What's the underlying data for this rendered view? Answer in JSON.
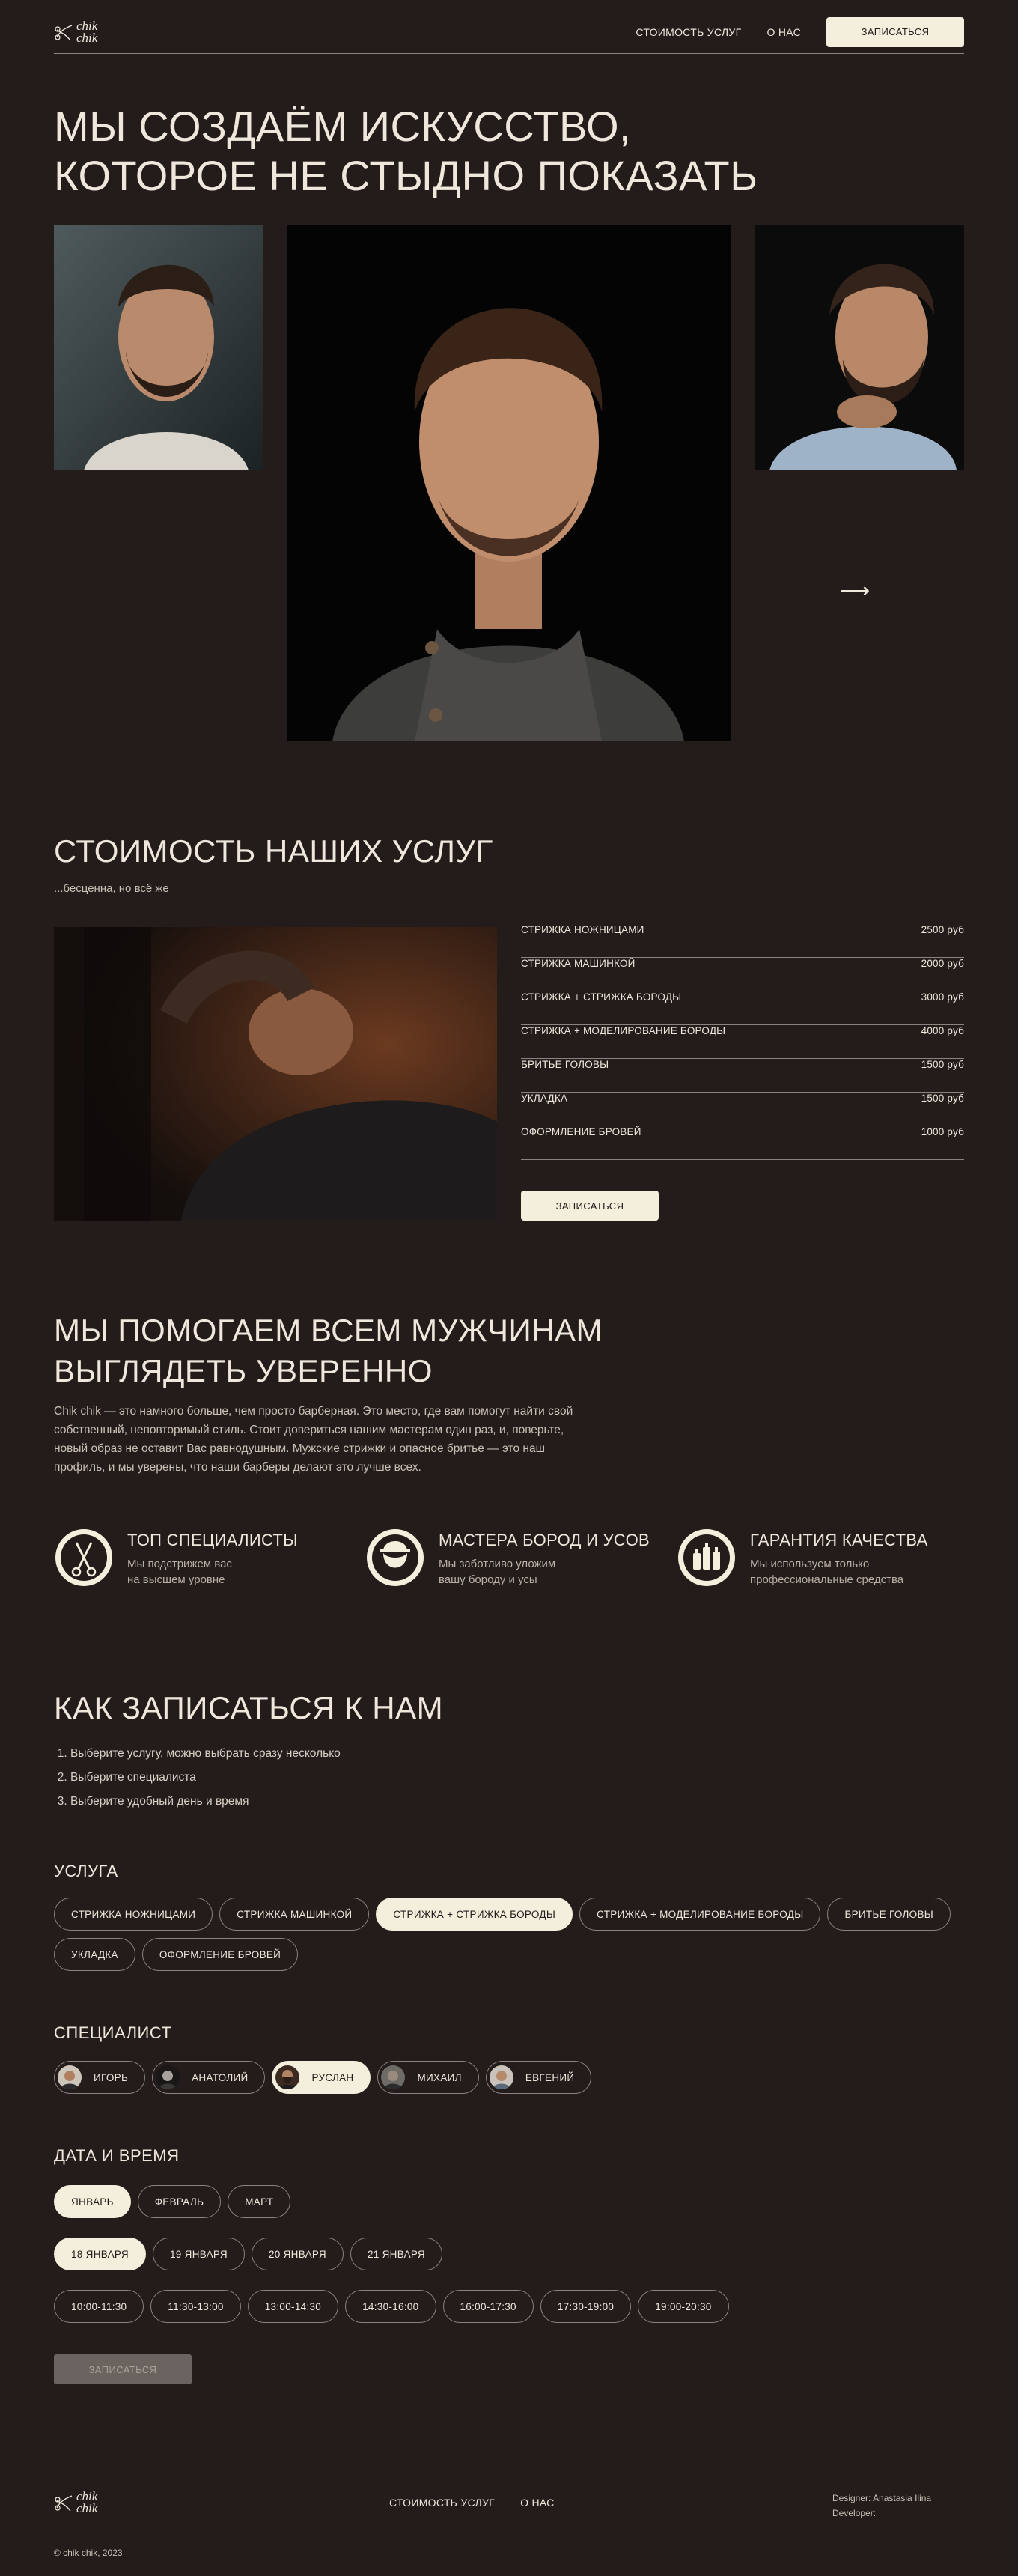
{
  "brand": {
    "logo_line1": "chik",
    "logo_line2": "chik"
  },
  "nav": {
    "prices": "СТОИМОСТЬ УСЛУГ",
    "about": "О НАС",
    "book_button": "ЗАПИСАТЬСЯ"
  },
  "hero": {
    "title_line1": "МЫ СОЗДАЁМ ИСКУССТВО,",
    "title_line2": "КОТОРОЕ НЕ СТЫДНО ПОКАЗАТЬ",
    "arrow": "⟶"
  },
  "prices": {
    "title": "СТОИМОСТЬ НАШИХ УСЛУГ",
    "subtitle": "...бесценна, но всё же",
    "items": [
      {
        "name": "СТРИЖКА НОЖНИЦАМИ",
        "price": "2500 руб"
      },
      {
        "name": "СТРИЖКА МАШИНКОЙ",
        "price": "2000 руб"
      },
      {
        "name": "СТРИЖКА + СТРИЖКА БОРОДЫ",
        "price": "3000 руб"
      },
      {
        "name": "СТРИЖКА + МОДЕЛИРОВАНИЕ БОРОДЫ",
        "price": "4000 руб"
      },
      {
        "name": "БРИТЬЕ ГОЛОВЫ",
        "price": "1500 руб"
      },
      {
        "name": "УКЛАДКА",
        "price": "1500 руб"
      },
      {
        "name": "ОФОРМЛЕНИЕ БРОВЕЙ",
        "price": "1000 руб"
      }
    ],
    "book_button": "ЗАПИСАТЬСЯ"
  },
  "about": {
    "title_line1": "МЫ ПОМОГАЕМ ВСЕМ МУЖЧИНАМ",
    "title_line2": "ВЫГЛЯДЕТЬ УВЕРЕННО",
    "text": "Chik chik — это намного больше, чем просто барберная. Это место, где вам помогут найти свой собственный, неповторимый стиль. Стоит довериться нашим мастерам один раз, и, поверьте, новый образ не оставит Вас равнодушным. Мужские стрижки и опасное бритье — это наш профиль, и мы уверены, что наши барберы делают это лучше всех.",
    "features": [
      {
        "title": "ТОП СПЕЦИАЛИСТЫ",
        "sub1": "Мы подстрижем вас",
        "sub2": "на высшем уровне",
        "icon": "scissors-icon"
      },
      {
        "title": "МАСТЕРА БОРОД И УСОВ",
        "sub1": "Мы заботливо уложим",
        "sub2": "вашу бороду и усы",
        "icon": "bearded-man-icon"
      },
      {
        "title": "ГАРАНТИЯ КАЧЕСТВА",
        "sub1": "Мы используем только",
        "sub2": "профессиональные средства",
        "icon": "bottles-icon"
      }
    ]
  },
  "booking": {
    "title": "КАК ЗАПИСАТЬСЯ К НАМ",
    "steps": [
      "Выберите услугу, можно выбрать сразу несколько",
      "Выберите специалиста",
      "Выберите удобный день и время"
    ],
    "service_label": "УСЛУГА",
    "services": [
      "СТРИЖКА НОЖНИЦАМИ",
      "СТРИЖКА МАШИНКОЙ",
      "СТРИЖКА + СТРИЖКА БОРОДЫ",
      "СТРИЖКА + МОДЕЛИРОВАНИЕ БОРОДЫ",
      "БРИТЬЕ ГОЛОВЫ",
      "УКЛАДКА",
      "ОФОРМЛЕНИЕ БРОВЕЙ"
    ],
    "service_selected": 2,
    "specialist_label": "СПЕЦИАЛИСТ",
    "specialists": [
      "ИГОРЬ",
      "АНАТОЛИЙ",
      "РУСЛАН",
      "МИХАИЛ",
      "ЕВГЕНИЙ"
    ],
    "specialist_selected": 2,
    "datetime_label": "ДАТА И ВРЕМЯ",
    "months": [
      "ЯНВАРЬ",
      "ФЕВРАЛЬ",
      "МАРТ"
    ],
    "month_selected": 0,
    "days": [
      "18 ЯНВАРЯ",
      "19 ЯНВАРЯ",
      "20 ЯНВАРЯ",
      "21 ЯНВАРЯ"
    ],
    "day_selected": 0,
    "times": [
      "10:00-11:30",
      "11:30-13:00",
      "13:00-14:30",
      "14:30-16:00",
      "16:00-17:30",
      "17:30-19:00",
      "19:00-20:30"
    ],
    "submit_button": "ЗАПИСАТЬСЯ"
  },
  "footer": {
    "prices": "СТОИМОСТЬ УСЛУГ",
    "about": "О НАС",
    "designer": "Designer: Anastasia Ilina",
    "developer": "Developer:",
    "copyright": "© chik chik, 2023"
  },
  "colors": {
    "background": "#241c1b",
    "light": "#f4eedc",
    "line": "#8a8380",
    "muted_button": "#6b6360"
  }
}
